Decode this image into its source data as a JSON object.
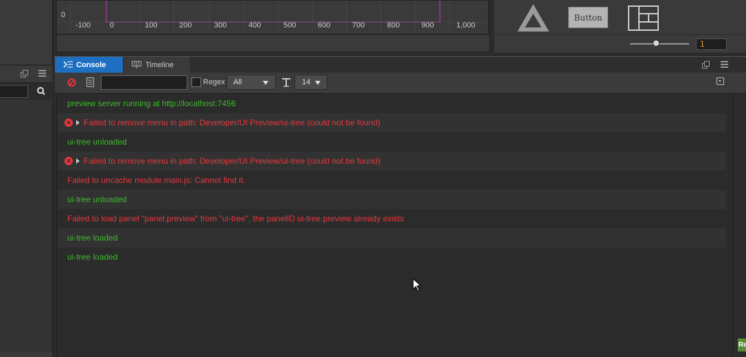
{
  "graph": {
    "y_tick": "0",
    "x_ticks": [
      "-100",
      "0",
      "100",
      "200",
      "300",
      "400",
      "500",
      "600",
      "700",
      "800",
      "900",
      "1,000"
    ]
  },
  "preview": {
    "button_label": "Button",
    "slider_value": "1"
  },
  "tabs": [
    {
      "label": "Console",
      "icon": "console-icon",
      "active": true
    },
    {
      "label": "Timeline",
      "icon": "timeline-icon",
      "active": false
    }
  ],
  "toolbar": {
    "filter_placeholder": "",
    "regex_label": "Regex",
    "level_select": "All",
    "font_size": "14"
  },
  "logs": [
    {
      "type": "log",
      "text": "preview server running at http://localhost:7456"
    },
    {
      "type": "error",
      "text": "Failed to remove menu in path: Developer/UI Preview/ui-tree (could not be found)"
    },
    {
      "type": "log",
      "text": "ui-tree unloaded"
    },
    {
      "type": "error",
      "text": "Failed to remove menu in path: Developer/UI Preview/ui-tree (could not be found)"
    },
    {
      "type": "failed",
      "text": "Failed to uncache module main.js: Cannot find it."
    },
    {
      "type": "log",
      "text": "ui-tree unloaded"
    },
    {
      "type": "failed",
      "text": "Failed to load panel \"panel.preview\" from \"ui-tree\", the panelID ui-tree.preview already exists"
    },
    {
      "type": "log",
      "text": "ui-tree loaded"
    },
    {
      "type": "log",
      "text": "ui-tree loaded"
    }
  ],
  "colors": {
    "log_green": "#3dbb2c",
    "error_red": "#e8373e",
    "active_tab": "#1e6fc2"
  },
  "corner_badge": "Re"
}
